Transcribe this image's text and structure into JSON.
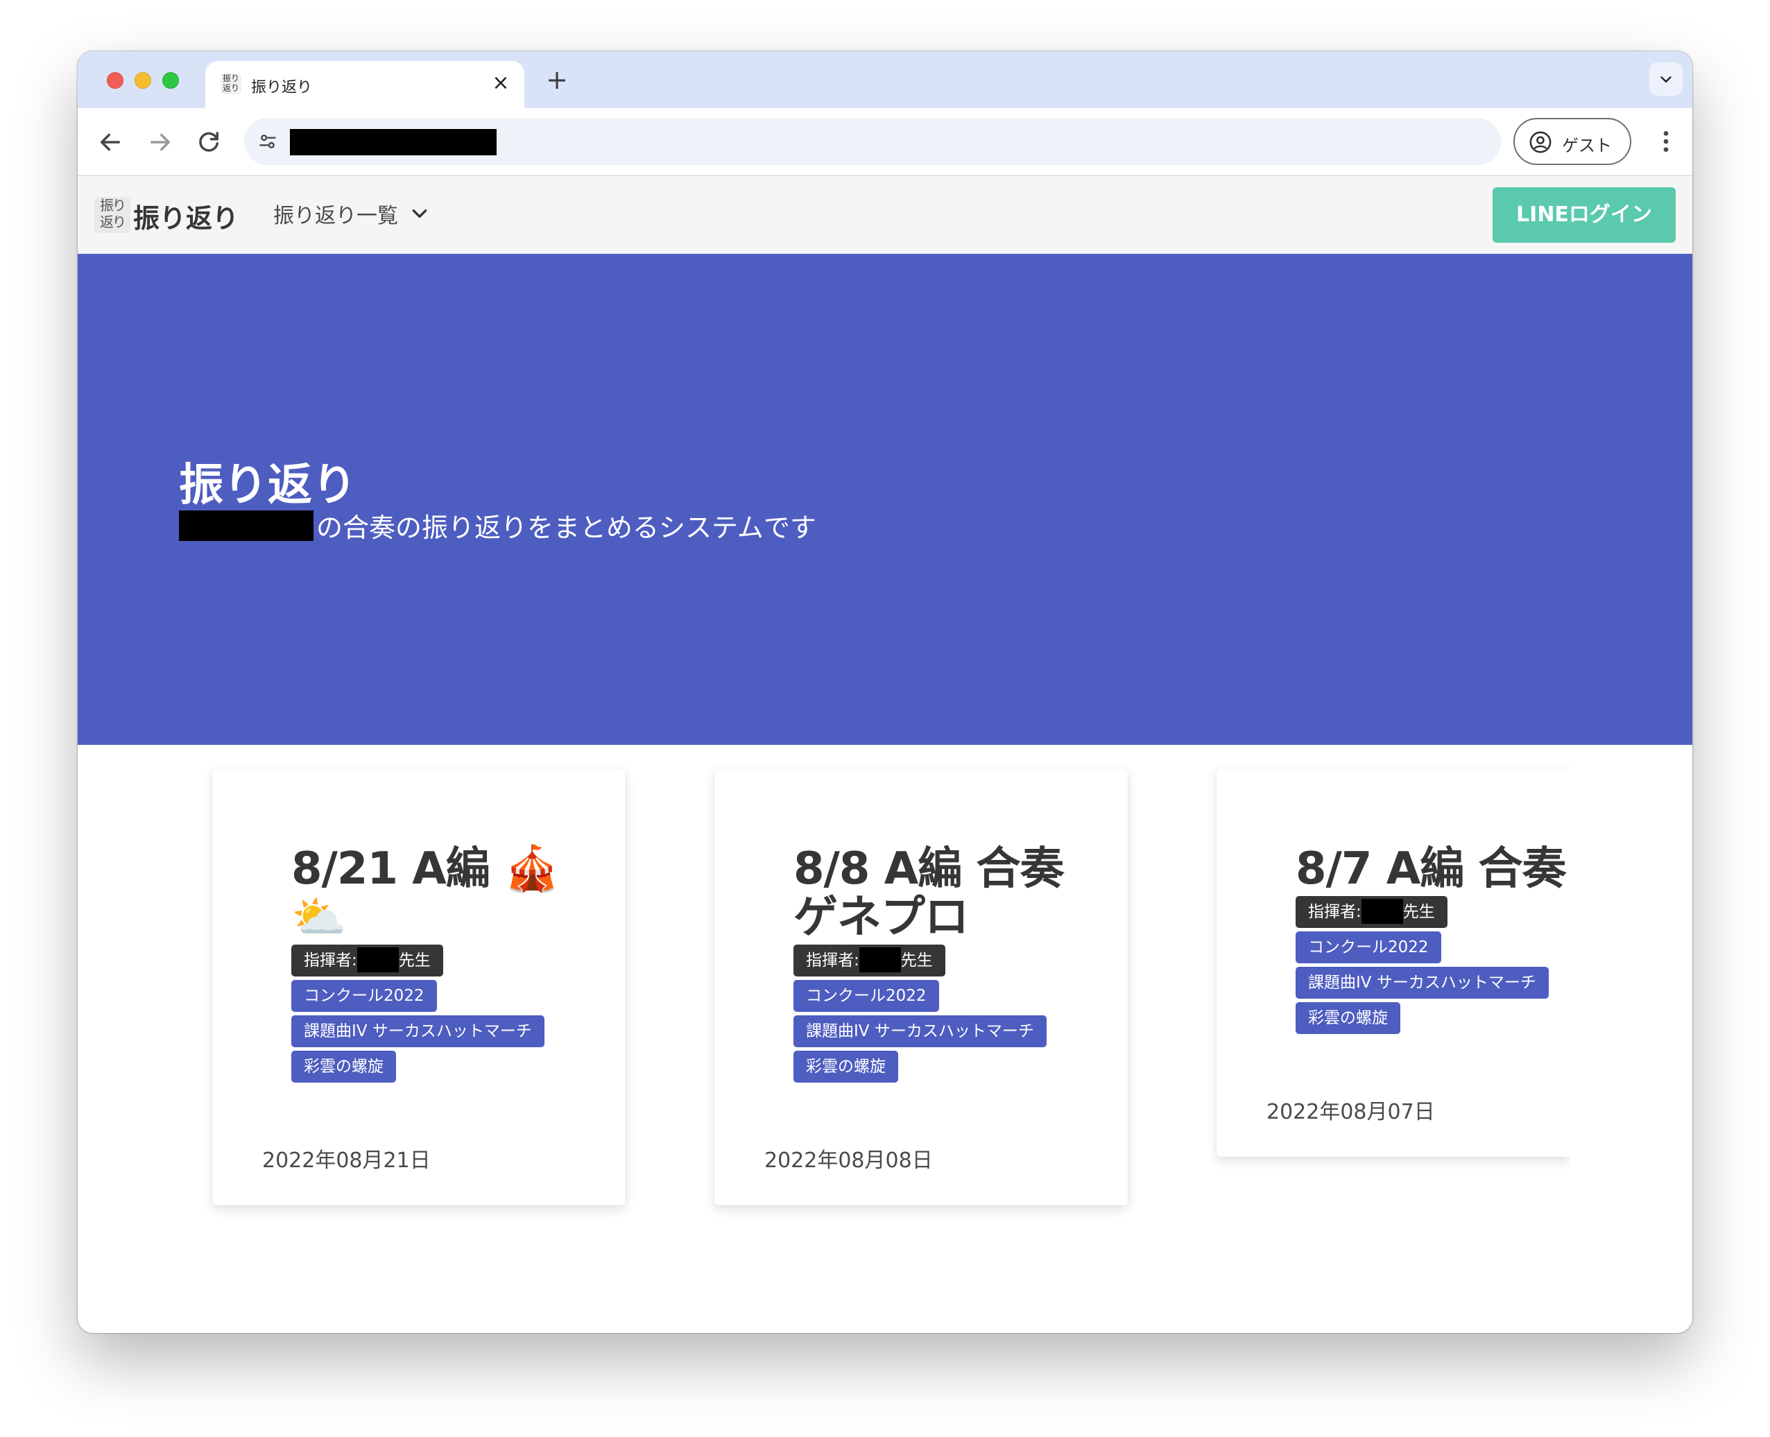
{
  "browser": {
    "tab_title": "振り返り",
    "tab_favicon_text": "振り返り",
    "new_tab_label": "+",
    "close_label": "×",
    "guest_label": "ゲスト"
  },
  "app": {
    "brand_logo_text": "振り返り",
    "brand_name": "振り返り",
    "menu_label": "振り返り一覧",
    "login_button": "LINEログイン"
  },
  "hero": {
    "title": "振り返り",
    "subtitle": "の合奏の振り返りをまとめるシステムです"
  },
  "cards": [
    {
      "title": "8/21 A編 🎪⛅",
      "conductor_prefix": "指揮者:",
      "conductor_suffix": "先生",
      "tags": [
        "コンクール2022",
        "課題曲IV サーカスハットマーチ",
        "彩雲の螺旋"
      ],
      "date": "2022年08月21日"
    },
    {
      "title": "8/8 A編 合奏ゲネプロ",
      "conductor_prefix": "指揮者:",
      "conductor_suffix": "先生",
      "tags": [
        "コンクール2022",
        "課題曲IV サーカスハットマーチ",
        "彩雲の螺旋"
      ],
      "date": "2022年08月08日"
    },
    {
      "title": "8/7 A編 合奏",
      "conductor_prefix": "指揮者:",
      "conductor_suffix": "先生",
      "tags": [
        "コンクール2022",
        "課題曲IV サーカスハットマーチ",
        "彩雲の螺旋"
      ],
      "date": "2022年08月07日"
    }
  ],
  "colors": {
    "hero_bg": "#4e5dc0",
    "tag_blue": "#4e5dc0",
    "tag_dark": "#363636",
    "login_button": "#5ac9ad",
    "tabstrip": "#d9e3f8"
  }
}
